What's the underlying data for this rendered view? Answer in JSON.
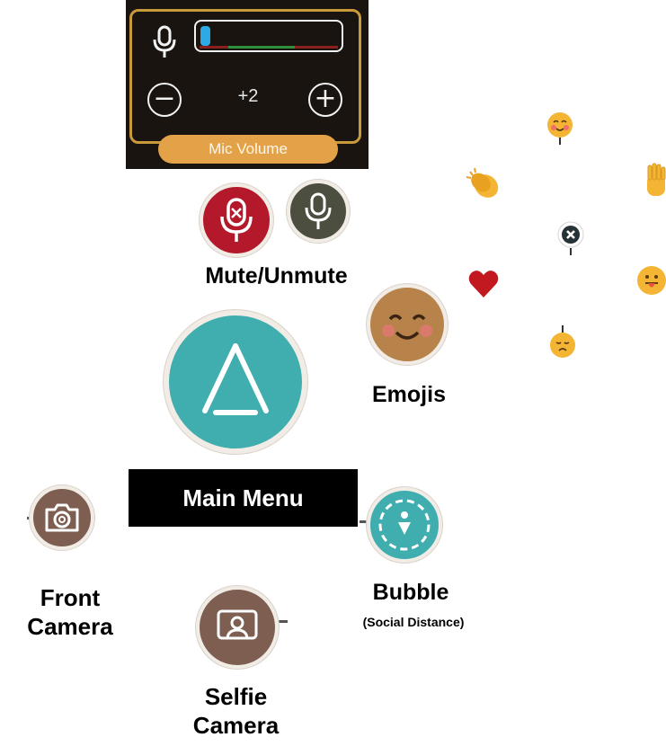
{
  "mic_volume": {
    "value": "+2",
    "label": "Mic Volume",
    "level": 0.05,
    "minus_symbol": "−",
    "plus_symbol": "+"
  },
  "labels": {
    "mute_unmute": "Mute/Unmute",
    "emojis": "Emojis",
    "main_menu": "Main Menu",
    "front_camera": "Front\nCamera",
    "bubble": "Bubble",
    "bubble_sub": "(Social Distance)",
    "selfie_camera": "Selfie\nCamera"
  },
  "icons": {
    "mic": "microphone-icon",
    "mic_muted": "microphone-muted-icon",
    "mic_unmuted": "microphone-icon",
    "emoji_button": "smiling-face-icon",
    "main_menu": "triangle-icon",
    "front_camera": "camera-icon",
    "bubble": "social-distance-bubble-icon",
    "selfie_camera": "selfie-camera-icon",
    "emoji_wheel": [
      "smiling-face-with-hand-icon",
      "clapping-hands-icon",
      "raised-hand-icon",
      "close-icon",
      "heart-icon",
      "tongue-face-icon",
      "unamused-face-icon"
    ]
  },
  "colors": {
    "panel_bg": "#1a1410",
    "panel_border": "#c99a3a",
    "pill": "#e3a247",
    "mute_red": "#b4192b",
    "unmute_olive": "#4c4e3f",
    "teal": "#40adaf",
    "brown": "#7d5e50",
    "emoji_yellow": "#f3b533",
    "heart": "#c2181f"
  }
}
